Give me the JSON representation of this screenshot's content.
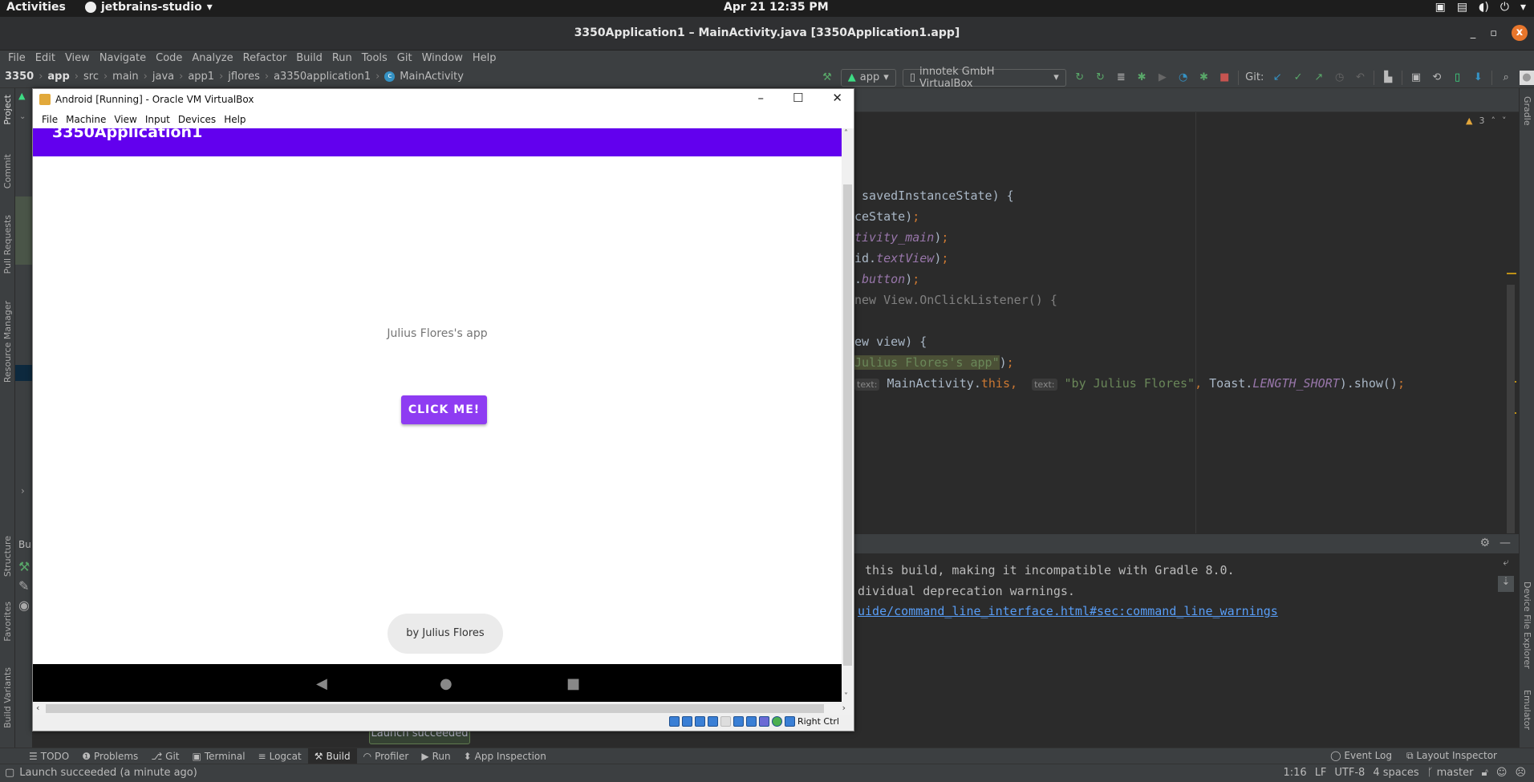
{
  "topbar": {
    "activities": "Activities",
    "app_name": "jetbrains-studio",
    "clock": "Apr 21  12:35 PM",
    "tray_icons": [
      "display-icon",
      "network-icon",
      "volume-icon",
      "power-icon",
      "chevron-down-icon"
    ]
  },
  "window": {
    "title": "3350Application1 – MainActivity.java [3350Application1.app]",
    "minimize": "_",
    "maximize": "▫",
    "close": "x"
  },
  "menu": [
    "File",
    "Edit",
    "View",
    "Navigate",
    "Code",
    "Analyze",
    "Refactor",
    "Build",
    "Run",
    "Tools",
    "Git",
    "Window",
    "Help"
  ],
  "breadcrumb": [
    "3350",
    "app",
    "src",
    "main",
    "java",
    "app1",
    "jflores",
    "a3350application1",
    "MainActivity"
  ],
  "toolbar": {
    "run_config": "app",
    "device": "innotek GmbH VirtualBox",
    "git_label": "Git:"
  },
  "left_stripe": [
    "Project",
    "Commit",
    "Pull Requests",
    "Resource Manager",
    "Structure",
    "Favorites",
    "Build Variants"
  ],
  "right_stripe": [
    "Gradle",
    "Device File Explorer",
    "Emulator"
  ],
  "editor": {
    "warnings_count": "3",
    "lines": [
      {
        "parts": [
          {
            "t": " savedInstanceState) {",
            "c": ""
          }
        ]
      },
      {
        "parts": [
          {
            "t": "ceState)",
            "c": ""
          },
          {
            "t": ";",
            "c": "kw"
          }
        ]
      },
      {
        "parts": [
          {
            "t": "tivity_main",
            "c": "it"
          },
          {
            "t": ")",
            "c": ""
          },
          {
            "t": ";",
            "c": "kw"
          }
        ]
      },
      {
        "parts": [
          {
            "t": "id.",
            "c": ""
          },
          {
            "t": "textView",
            "c": "it"
          },
          {
            "t": ")",
            "c": ""
          },
          {
            "t": ";",
            "c": "kw"
          }
        ]
      },
      {
        "parts": [
          {
            "t": ".",
            "c": ""
          },
          {
            "t": "button",
            "c": "it"
          },
          {
            "t": ")",
            "c": ""
          },
          {
            "t": ";",
            "c": "kw"
          }
        ]
      },
      {
        "parts": [
          {
            "t": "new View.OnClickListener() {",
            "c": "gr"
          }
        ]
      },
      {
        "parts": [
          {
            "t": "",
            "c": ""
          }
        ]
      },
      {
        "parts": [
          {
            "t": "ew view) {",
            "c": ""
          }
        ]
      },
      {
        "parts": [
          {
            "t": "Julius Flores's app\"",
            "c": "str hl"
          },
          {
            "t": ")",
            "c": ""
          },
          {
            "t": ";",
            "c": "kw"
          }
        ]
      },
      {
        "parts": [
          {
            "t": "text:",
            "c": "hint"
          },
          {
            "t": " MainActivity.",
            "c": ""
          },
          {
            "t": "this",
            "c": "kw"
          },
          {
            "t": ",  ",
            "c": "kw"
          },
          {
            "t": "text:",
            "c": "hint"
          },
          {
            "t": " \"by Julius Flores\"",
            "c": "str"
          },
          {
            "t": ", ",
            "c": "kw"
          },
          {
            "t": "Toast.",
            "c": ""
          },
          {
            "t": "LENGTH_SHORT",
            "c": "it"
          },
          {
            "t": ").show()",
            "c": ""
          },
          {
            "t": ";",
            "c": "kw"
          }
        ]
      }
    ]
  },
  "build_output": {
    "panel_label": "Bu",
    "lines": [
      " this build, making it incompatible with Gradle 8.0.",
      "dividual deprecation warnings."
    ],
    "link": "uide/command_line_interface.html#sec:command_line_warnings"
  },
  "tool_windows": [
    {
      "icon": "list-icon",
      "label": "TODO"
    },
    {
      "icon": "problems-icon",
      "label": "Problems"
    },
    {
      "icon": "git-icon",
      "label": "Git"
    },
    {
      "icon": "terminal-icon",
      "label": "Terminal"
    },
    {
      "icon": "logcat-icon",
      "label": "Logcat"
    },
    {
      "icon": "hammer-icon",
      "label": "Build",
      "active": true
    },
    {
      "icon": "profiler-icon",
      "label": "Profiler"
    },
    {
      "icon": "run-icon",
      "label": "Run"
    },
    {
      "icon": "inspection-icon",
      "label": "App Inspection"
    }
  ],
  "tool_windows_right": [
    "Event Log",
    "Layout Inspector"
  ],
  "tooltip": "Launch succeeded",
  "status": {
    "message": "Launch succeeded (a minute ago)",
    "position": "1:16",
    "line_sep": "LF",
    "encoding": "UTF-8",
    "indent": "4 spaces",
    "branch": "master"
  },
  "vbox": {
    "title": "Android [Running] - Oracle VM VirtualBox",
    "menu": [
      "File",
      "Machine",
      "View",
      "Input",
      "Devices",
      "Help"
    ],
    "host_key": "Right Ctrl"
  },
  "android": {
    "app_title": "3350Application1",
    "text_view": "Julius Flores's app",
    "button": "CLICK ME!",
    "toast": "by Julius Flores",
    "colors": {
      "primary": "#6200ee",
      "button": "#8e3cf2"
    }
  }
}
